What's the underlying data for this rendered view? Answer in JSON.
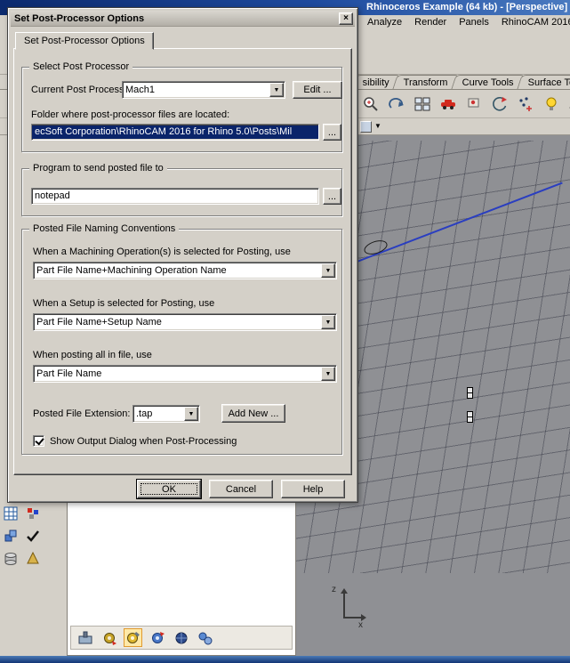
{
  "colors": {
    "selection_blue": "#0a246a",
    "titlebar_blue": "#1e4a9e",
    "face_gray": "#d4d0c8",
    "viewport_gray": "#8f9094",
    "active_tool_highlight": "#ffe9a8",
    "construction_line_blue": "#2a3ec0"
  },
  "icons": {
    "close": "×",
    "dropdown": "▼"
  },
  "app": {
    "title_fragment": "Rhinoceros Example (64 kb) - [Perspective]",
    "menu": [
      "Analyze",
      "Render",
      "Panels",
      "RhinoCAM 2016"
    ],
    "toolbar_tabs": [
      "sibility",
      "Transform",
      "Curve Tools",
      "Surface To"
    ],
    "viewport": {
      "axis_z": "z",
      "axis_x": "x"
    }
  },
  "dialog": {
    "title": "Set Post-Processor Options",
    "tab": "Set Post-Processor Options",
    "groups": {
      "select_post": {
        "title": "Select Post Processor",
        "current_label": "Current Post Processor:",
        "current_value": "Mach1",
        "edit_button": "Edit ...",
        "folder_label": "Folder where post-processor files are located:",
        "folder_value": "ecSoft Corporation\\RhinoCAM 2016 for Rhino 5.0\\Posts\\Mil",
        "browse_button": "..."
      },
      "program": {
        "title": "Program to send posted file to",
        "value": "notepad",
        "browse_button": "..."
      },
      "naming": {
        "title": "Posted File Naming Conventions",
        "op_label": "When a Machining Operation(s) is selected for Posting, use",
        "op_value": "Part File Name+Machining Operation Name",
        "setup_label": "When a Setup is selected for Posting, use",
        "setup_value": "Part File Name+Setup Name",
        "all_label": "When posting all in file, use",
        "all_value": "Part File Name",
        "ext_label": "Posted File Extension:",
        "ext_value": ".tap",
        "add_new_button": "Add New ...",
        "show_output_label": "Show Output Dialog when Post-Processing",
        "show_output_checked": true
      }
    },
    "buttons": {
      "ok": "OK",
      "cancel": "Cancel",
      "help": "Help"
    }
  }
}
